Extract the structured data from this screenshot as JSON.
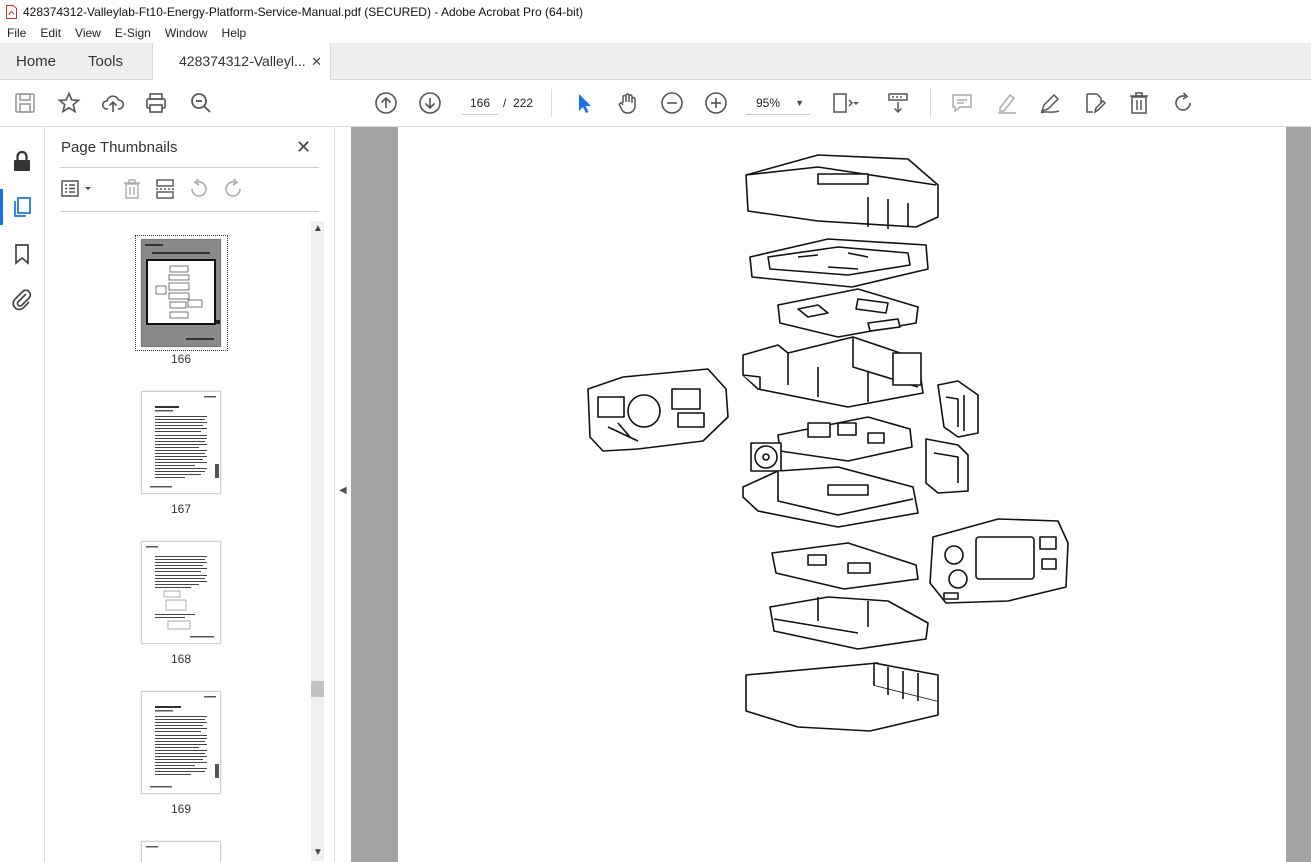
{
  "window": {
    "title": "428374312-Valleylab-Ft10-Energy-Platform-Service-Manual.pdf (SECURED) - Adobe Acrobat Pro (64-bit)"
  },
  "menu": [
    "File",
    "Edit",
    "View",
    "E-Sign",
    "Window",
    "Help"
  ],
  "tabs": {
    "home": "Home",
    "tools": "Tools",
    "document": "428374312-Valleyl...",
    "close_glyph": "✕"
  },
  "toolbar": {
    "page_current": "166",
    "page_separator": "/",
    "page_total": "222",
    "zoom": "95%"
  },
  "thumbnails_panel": {
    "title": "Page Thumbnails",
    "close_glyph": "✕",
    "pages": [
      {
        "label": "166",
        "selected": true
      },
      {
        "label": "167",
        "selected": false
      },
      {
        "label": "168",
        "selected": false
      },
      {
        "label": "169",
        "selected": false
      }
    ]
  },
  "colors": {
    "accent": "#1473e6",
    "doc_background": "#a3a3a3",
    "tab_bar": "#eeeeee"
  },
  "icons": {
    "toolbar_left": [
      "save-icon",
      "bookmark-star-icon",
      "upload-cloud-icon",
      "print-icon",
      "zoom-search-icon"
    ],
    "toolbar_nav": [
      "page-up-icon",
      "page-down-icon"
    ],
    "toolbar_tools": [
      "select-cursor-icon",
      "hand-pan-icon",
      "zoom-out-icon",
      "zoom-in-icon",
      "page-fit-icon",
      "scroll-mode-icon"
    ],
    "toolbar_right": [
      "comment-icon",
      "highlight-pen-icon",
      "sign-icon",
      "edit-pdf-icon",
      "delete-icon",
      "rotate-icon"
    ],
    "left_rail": [
      "lock-icon",
      "pages-icon",
      "bookmark-icon",
      "attachment-icon"
    ]
  }
}
